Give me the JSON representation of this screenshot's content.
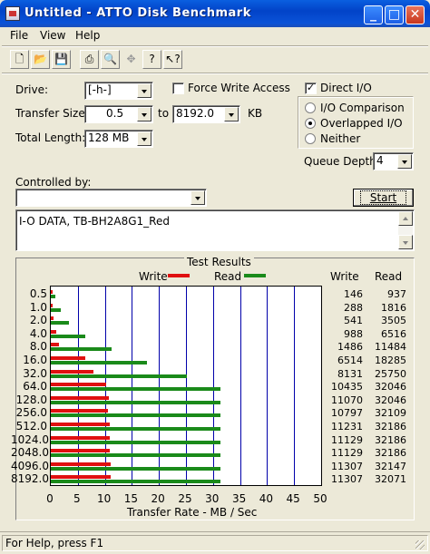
{
  "window": {
    "title": "Untitled - ATTO Disk Benchmark",
    "minimize_glyph": "_",
    "maximize_glyph": "□",
    "close_glyph": "✕"
  },
  "menu": {
    "file": "File",
    "view": "View",
    "help": "Help"
  },
  "toolbar": [
    "new-icon",
    "open-icon",
    "save-icon",
    "print-icon",
    "print-preview-icon",
    "move-icon",
    "help-icon",
    "context-help-icon"
  ],
  "settings": {
    "drive_label": "Drive:",
    "drive_value": "[-h-]",
    "force_write_label": "Force Write Access",
    "force_write_checked": false,
    "transfer_size_label": "Transfer Size:",
    "transfer_from": "0.5",
    "to_label": "to",
    "transfer_to": "8192.0",
    "kb_label": "KB",
    "total_length_label": "Total Length:",
    "total_length_value": "128 MB",
    "direct_io_label": "Direct I/O",
    "direct_io_checked": true,
    "io_comparison_label": "I/O Comparison",
    "overlapped_io_label": "Overlapped I/O",
    "neither_label": "Neither",
    "selected_mode": "Overlapped I/O",
    "queue_depth_label": "Queue Depth:",
    "queue_depth_value": "4",
    "controlled_by_label": "Controlled by:",
    "controlled_by_value": "",
    "start_label": "Start",
    "description": "I-O DATA, TB-BH2A8G1_Red"
  },
  "results": {
    "title": "Test Results",
    "write_legend": "Write",
    "read_legend": "Read",
    "write_col": "Write",
    "read_col": "Read",
    "write_color": "#e01010",
    "read_color": "#1a8a1a"
  },
  "chart_data": {
    "type": "bar",
    "orientation": "horizontal",
    "title": "Test Results",
    "xlabel": "Transfer Rate - MB / Sec",
    "xlim": [
      0,
      50
    ],
    "xticks": [
      "0",
      "5",
      "10",
      "15",
      "20",
      "25",
      "30",
      "35",
      "40",
      "45",
      "50"
    ],
    "categories": [
      "0.5",
      "1.0",
      "2.0",
      "4.0",
      "8.0",
      "16.0",
      "32.0",
      "64.0",
      "128.0",
      "256.0",
      "512.0",
      "1024.0",
      "2048.0",
      "4096.0",
      "8192.0"
    ],
    "series": [
      {
        "name": "Write",
        "values_mb": [
          0.14,
          0.28,
          0.53,
          0.96,
          1.45,
          6.36,
          7.94,
          10.19,
          10.81,
          10.54,
          10.97,
          10.87,
          10.87,
          11.04,
          11.04
        ],
        "values_kb": [
          "146",
          "288",
          "541",
          "988",
          "1486",
          "6514",
          "8131",
          "10435",
          "11070",
          "10797",
          "11231",
          "11129",
          "11129",
          "11307",
          "11307"
        ]
      },
      {
        "name": "Read",
        "values_mb": [
          0.92,
          1.77,
          3.42,
          6.36,
          11.21,
          17.86,
          25.15,
          31.3,
          31.3,
          31.36,
          31.43,
          31.43,
          31.43,
          31.39,
          31.32
        ],
        "values_kb": [
          "937",
          "1816",
          "3505",
          "6516",
          "11484",
          "18285",
          "25750",
          "32046",
          "32046",
          "32109",
          "32186",
          "32186",
          "32186",
          "32147",
          "32071"
        ]
      }
    ]
  },
  "status": {
    "text": "For Help, press F1"
  }
}
